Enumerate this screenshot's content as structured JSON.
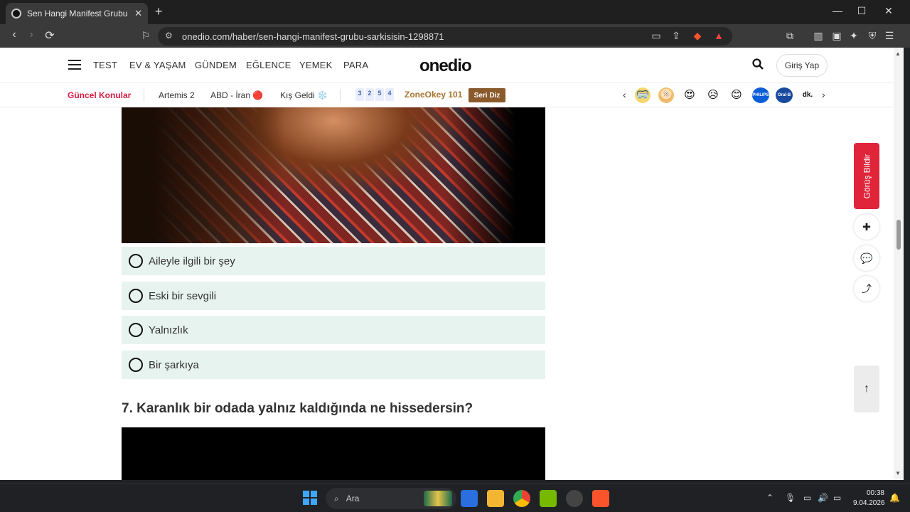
{
  "browser": {
    "tab_title": "Sen Hangi Manifest Grubu Şarkısısın",
    "tab_close": "✕",
    "new_tab": "+",
    "url": "onedio.com/haber/sen-hangi-manifest-grubu-sarkisisin-1298871",
    "window_controls": {
      "minimize": "—",
      "maximize": "☐",
      "close": "✕"
    }
  },
  "header": {
    "nav": [
      "TEST",
      "EV & YAŞAM",
      "GÜNDEM",
      "EĞLENCE",
      "YEMEK",
      "PARA"
    ],
    "logo": "onedio",
    "login_label": "Giriş Yap"
  },
  "topics": {
    "label": "Güncel Konular",
    "items": [
      "Artemis 2",
      "ABD - İran 🔴",
      "Kış Geldi ❄️"
    ],
    "tiles": [
      "3",
      "2",
      "5",
      "4"
    ],
    "zone_label": "ZoneOkey 101",
    "seri_label": "Seri Diz",
    "emojis": [
      "🥽",
      "🫓",
      "😍",
      "😥",
      "😊"
    ],
    "brands": [
      "PHILIPS",
      "Oral-B",
      "dk."
    ],
    "brand_colors": [
      "#0b5ed7",
      "#1a4aa0",
      "#ffffff"
    ]
  },
  "quiz": {
    "options": [
      "Aileyle ilgili bir şey",
      "Eski bir sevgili",
      "Yalnızlık",
      "Bir şarkıya"
    ],
    "next_question": "7. Karanlık bir odada yalnız kaldığında ne hissedersin?"
  },
  "sidebar": {
    "feedback_label": "Görüş Bildir"
  },
  "taskbar": {
    "search_placeholder": "Ara",
    "time": "00:38",
    "date": "9.04.2026"
  },
  "colors": {
    "accent_red": "#e0243a",
    "option_bg": "#e7f3ee",
    "topic_red": "#d81b3f"
  }
}
